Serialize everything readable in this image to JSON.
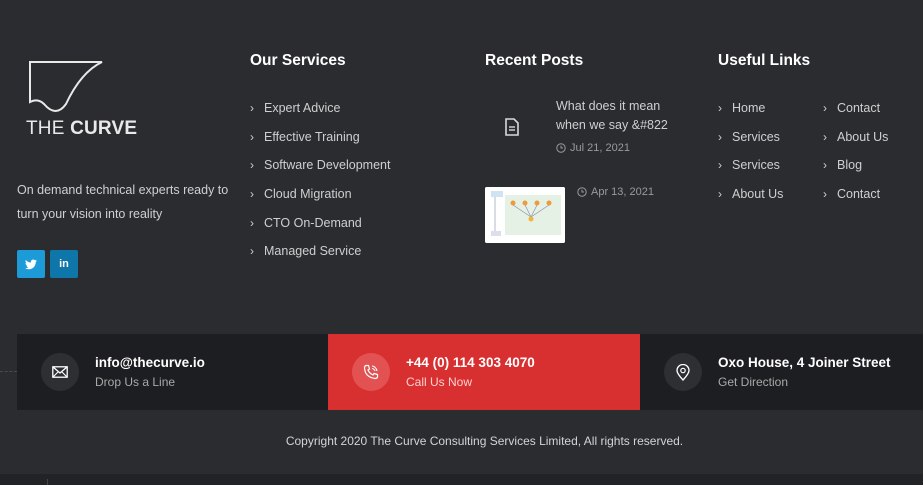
{
  "brand": {
    "logo_text_light": "THE ",
    "logo_text_bold": "CURVE",
    "tagline": "On demand technical experts ready to turn your vision into reality",
    "social": [
      {
        "name": "twitter",
        "glyph": "t",
        "color": "#1d9bd8"
      },
      {
        "name": "linkedin",
        "glyph": "in",
        "color": "#0e76a8"
      }
    ]
  },
  "services": {
    "heading": "Our Services",
    "items": [
      "Expert Advice",
      "Effective Training",
      "Software Development",
      "Cloud Migration",
      "CTO On-Demand",
      "Managed Service"
    ]
  },
  "recent_posts": {
    "heading": "Recent Posts",
    "posts": [
      {
        "title": "What does it mean when we say &#822",
        "date": "Jul 21, 2021",
        "icon": "document-icon"
      },
      {
        "title": "",
        "date": "Apr 13, 2021",
        "icon": "diagram-thumbnail"
      }
    ]
  },
  "useful_links": {
    "heading": "Useful Links",
    "col1": [
      "Home",
      "Services",
      "Services",
      "About Us"
    ],
    "col2": [
      "Contact",
      "About Us",
      "Blog",
      "Contact"
    ]
  },
  "contact_bar": [
    {
      "main": "info@thecurve.io",
      "sub": "Drop Us a Line",
      "icon": "envelope-icon"
    },
    {
      "main": "+44 (0) 114 303 4070",
      "sub": "Call Us Now",
      "icon": "phone-icon"
    },
    {
      "main": "Oxo House, 4 Joiner Street",
      "sub": "Get Direction",
      "icon": "location-pin-icon"
    }
  ],
  "copyright": "Copyright 2020 The Curve Consulting Services Limited, All rights reserved.",
  "colors": {
    "background": "#2b2c30",
    "accent_red": "#d83030",
    "dark_box": "#1d1e21",
    "twitter": "#1d9bd8",
    "linkedin": "#0e76a8"
  }
}
